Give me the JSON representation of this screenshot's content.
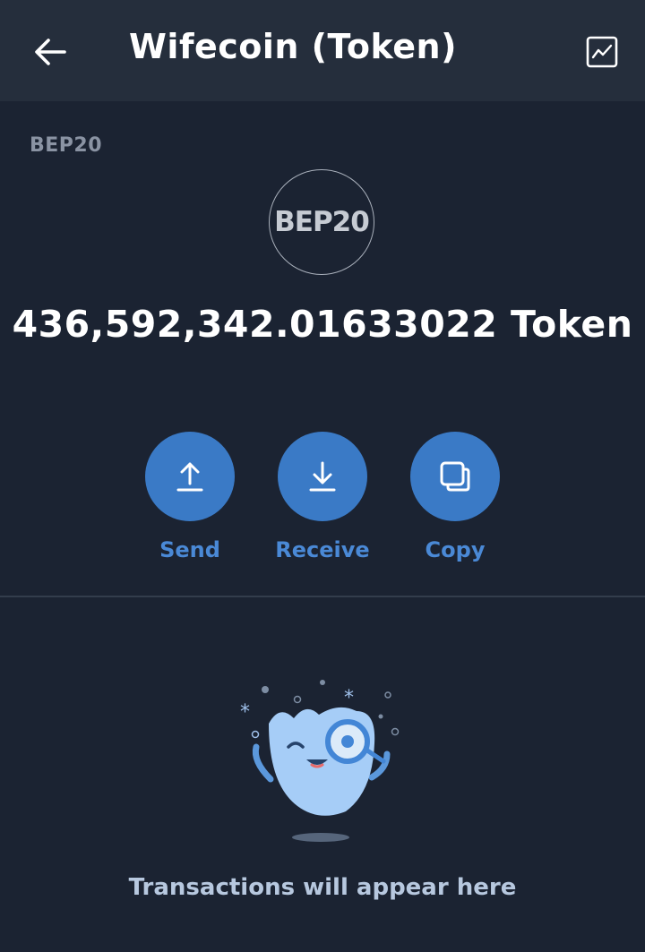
{
  "header": {
    "title": "Wifecoin (Token)",
    "back_icon": "arrow-left-icon",
    "chart_icon": "chart-line-icon"
  },
  "token": {
    "network": "BEP20",
    "logo_text": "BEP20",
    "balance": "436,592,342.01633022 Token"
  },
  "actions": [
    {
      "label": "Send",
      "icon": "upload-arrow-icon"
    },
    {
      "label": "Receive",
      "icon": "download-arrow-icon"
    },
    {
      "label": "Copy",
      "icon": "copy-icon"
    }
  ],
  "empty_state": {
    "message": "Transactions will appear here"
  },
  "colors": {
    "background": "#1b2332",
    "header": "#252e3c",
    "accent": "#3a7ac6",
    "accent_text": "#4a89d6"
  }
}
